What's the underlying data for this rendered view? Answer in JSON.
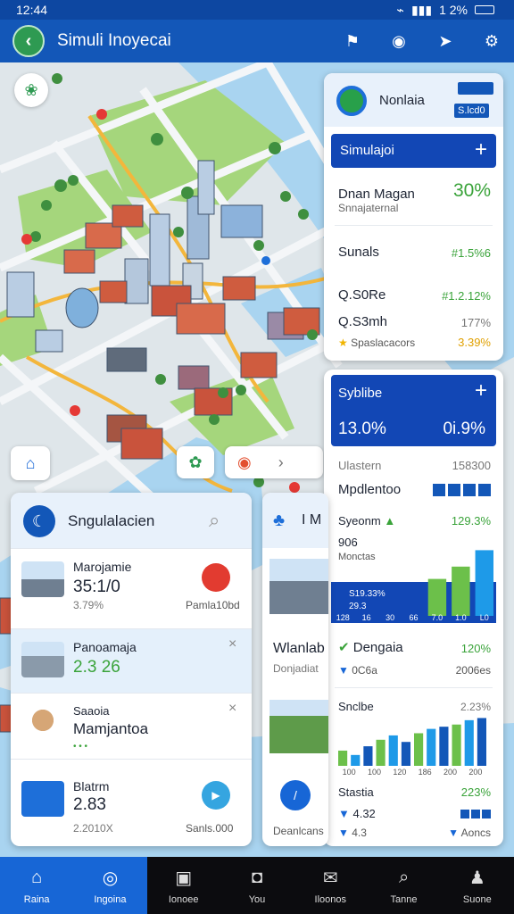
{
  "status": {
    "time": "12:44",
    "battery": "1 2%"
  },
  "appbar": {
    "title": "Simuli Inoyecai"
  },
  "map": {
    "buttons": [
      "house-icon",
      "gift-icon",
      "pin-icon",
      "chevron-right-icon"
    ]
  },
  "right_panel": {
    "header_title": "Nonlaia",
    "header_badge": "S.lcd0",
    "section1_title": "Simulajoi",
    "row1_label": "Dnan Magan",
    "row1_sub": "Snnajaternal",
    "row1_value": "30%",
    "row2_label": "Sunals",
    "row2_value": "#1.5%6",
    "row3_label": "Q.S0Re",
    "row3_value": "#1.2.12%",
    "row4_label": "Q.S3mh",
    "row4_value": "177%",
    "row5_label": "Spaslacacors",
    "row5_value": "3.39%",
    "section2_title": "Syblibe",
    "section2_left": "13.0%",
    "section2_right": "0i.9%",
    "row6_label": "Ulastern",
    "row6_value": "158300",
    "row7_label": "Mpdlentoo",
    "row8_label": "Syeonm",
    "row8_value": "129.3%",
    "row8_sub1": "906",
    "row8_sub2": "Monctas",
    "row9_label": "Dengaia",
    "row9_value": "120%",
    "row9_sub1": "0C6a",
    "row9_sub2": "2006es",
    "row10_label": "Snclbe",
    "row10_value": "2.23%",
    "row11_label": "Stastia",
    "row11_value": "223%",
    "row11_sub1": "4.32",
    "row11_sub2": "Aoncs"
  },
  "chart_data": [
    {
      "type": "bar",
      "categories": [
        "128",
        "16",
        "30",
        "66",
        "7.0",
        "1.0",
        "L0"
      ],
      "series": [
        {
          "values": [
            0,
            0,
            0,
            0,
            18,
            24,
            32
          ]
        }
      ],
      "title": "",
      "data_labels": [
        "S19.33%",
        "29.3"
      ]
    },
    {
      "type": "bar",
      "categories": [
        "100",
        "100",
        "120",
        "186",
        "200",
        "200"
      ],
      "series": [
        {
          "values": [
            14,
            10,
            18,
            24,
            28,
            22,
            30,
            34,
            36,
            38,
            42,
            44
          ]
        }
      ],
      "title": ""
    }
  ],
  "list_panel": {
    "title": "Sngulalacien",
    "items": [
      {
        "title": "Marojamie",
        "value": "35:1/0",
        "sub": "3.79%",
        "meta": "Pamla10bd"
      },
      {
        "title": "Panoamaja",
        "value": "2.3 26",
        "sub": "",
        "meta": ""
      },
      {
        "title": "Saaoia",
        "value": "Mamjantoa",
        "sub": "",
        "meta": ""
      },
      {
        "title": "Blatrm",
        "value": "2.83",
        "sub": "2.2010X",
        "meta": "Sanls.000"
      }
    ]
  },
  "mid_panel": {
    "title": "I M",
    "label": "Wlanlab",
    "sub": "Donjadiat",
    "footer": "Deanlcans"
  },
  "nav": [
    {
      "label": "Raina",
      "icon": "home-icon"
    },
    {
      "label": "Ingoina",
      "icon": "compass-icon"
    },
    {
      "label": "Ionoee",
      "icon": "camera-icon"
    },
    {
      "label": "You",
      "icon": "shield-icon"
    },
    {
      "label": "Iloonos",
      "icon": "mail-icon"
    },
    {
      "label": "Tanne",
      "icon": "search-icon"
    },
    {
      "label": "Suone",
      "icon": "person-icon"
    }
  ]
}
